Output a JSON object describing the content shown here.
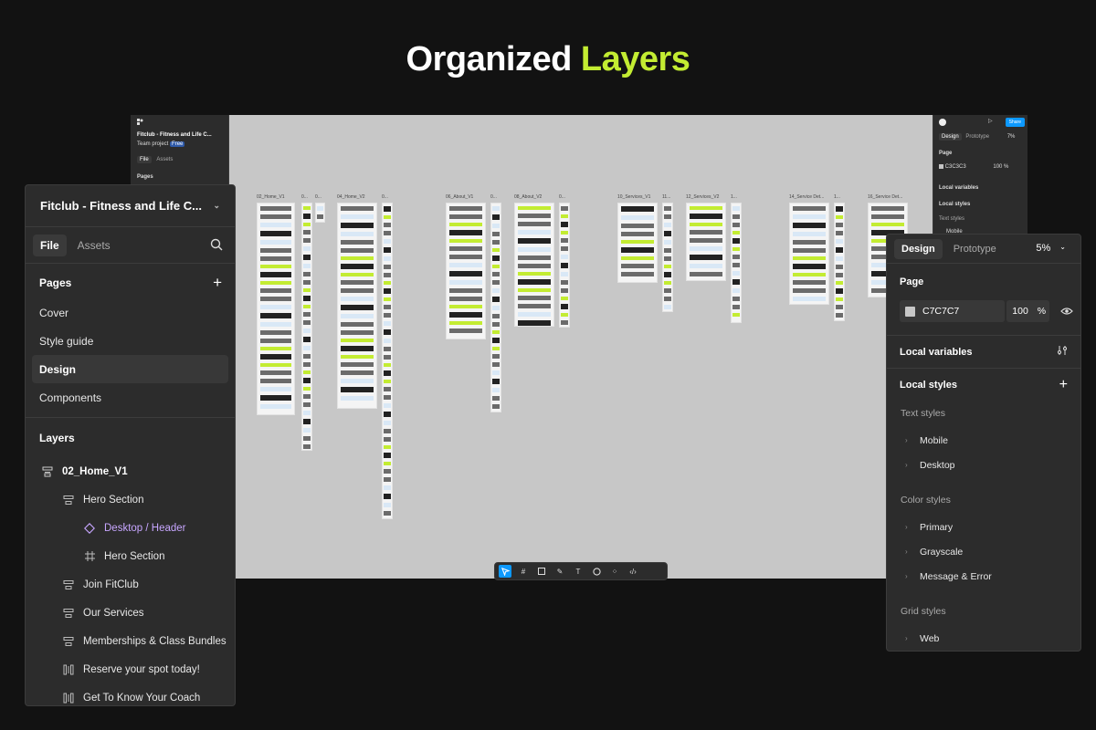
{
  "headline": {
    "prefix": "Organized",
    "accent": "Layers"
  },
  "colors": {
    "accent": "#c3ec32",
    "canvas": "#c7c7c7",
    "panel": "#2c2c2c",
    "component": "#c7a6ff",
    "share": "#0d99ff"
  },
  "background_app": {
    "file_title": "Fitclub - Fitness and Life C...",
    "team": "Team project",
    "plan_badge": "Free",
    "tabs": [
      "File",
      "Assets"
    ],
    "pages_label": "Pages",
    "right": {
      "tabs": [
        "Design",
        "Prototype"
      ],
      "zoom": "7%",
      "page_label": "Page",
      "hex": "C3C3C3",
      "opacity": "100",
      "percent": "%",
      "local_variables": "Local variables",
      "local_styles": "Local styles",
      "text_styles": "Text styles",
      "mobile": "Mobile",
      "share": "Share"
    },
    "frames": [
      {
        "label": "02_Home_V1"
      },
      {
        "label": "0..."
      },
      {
        "label": "0..."
      },
      {
        "label": "04_Home_V2"
      },
      {
        "label": "0..."
      },
      {
        "label": "06_About_V1"
      },
      {
        "label": "0..."
      },
      {
        "label": "08_About_V2"
      },
      {
        "label": "0..."
      },
      {
        "label": "10_Services_V1"
      },
      {
        "label": "11..."
      },
      {
        "label": "12_Services_V2"
      },
      {
        "label": "1..."
      },
      {
        "label": "14_Service Det..."
      },
      {
        "label": "1..."
      },
      {
        "label": "16_Service Det..."
      }
    ]
  },
  "layers_panel": {
    "file_title": "Fitclub - Fitness and Life C...",
    "tabs": {
      "file": "File",
      "assets": "Assets"
    },
    "pages_title": "Pages",
    "pages": [
      {
        "label": "Cover",
        "selected": false
      },
      {
        "label": "Style guide",
        "selected": false
      },
      {
        "label": "Design",
        "selected": true
      },
      {
        "label": "Components",
        "selected": false
      }
    ],
    "layers_title": "Layers",
    "layers": [
      {
        "label": "02_Home_V1",
        "icon": "frame-section-icon",
        "indent": 0,
        "kind": "root"
      },
      {
        "label": "Hero Section",
        "icon": "section-icon",
        "indent": 1,
        "kind": "section"
      },
      {
        "label": "Desktop / Header",
        "icon": "component-instance-icon",
        "indent": 2,
        "kind": "component"
      },
      {
        "label": "Hero Section",
        "icon": "frame-icon",
        "indent": 2,
        "kind": "frame"
      },
      {
        "label": "Join FitClub",
        "icon": "section-icon",
        "indent": 1,
        "kind": "section"
      },
      {
        "label": "Our Services",
        "icon": "section-icon",
        "indent": 1,
        "kind": "section"
      },
      {
        "label": "Memberships & Class Bundles",
        "icon": "section-icon",
        "indent": 1,
        "kind": "section"
      },
      {
        "label": "Reserve your spot today!",
        "icon": "autolayout-icon",
        "indent": 1,
        "kind": "autolayout"
      },
      {
        "label": "Get To Know Your Coach",
        "icon": "autolayout-icon",
        "indent": 1,
        "kind": "autolayout"
      }
    ]
  },
  "design_panel": {
    "tabs": {
      "design": "Design",
      "prototype": "Prototype"
    },
    "zoom": "5%",
    "page_title": "Page",
    "page_color": {
      "hex": "C7C7C7",
      "opacity": "100",
      "percent": "%"
    },
    "local_variables": "Local variables",
    "local_styles": "Local styles",
    "groups": [
      {
        "title": "Text styles",
        "items": [
          "Mobile",
          "Desktop"
        ]
      },
      {
        "title": "Color styles",
        "items": [
          "Primary",
          "Grayscale",
          "Message & Error"
        ]
      },
      {
        "title": "Grid styles",
        "items": [
          "Web"
        ]
      }
    ]
  }
}
